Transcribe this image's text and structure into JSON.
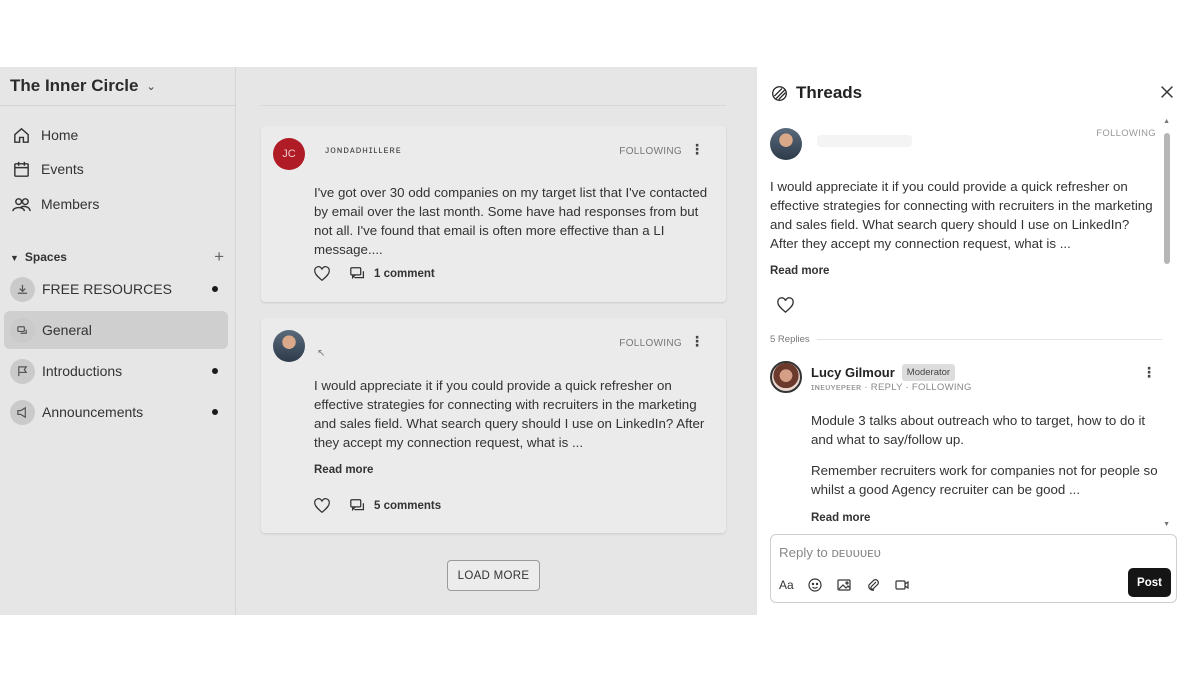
{
  "community": {
    "name": "The Inner Circle"
  },
  "nav": [
    {
      "label": "Home",
      "icon": "home-icon"
    },
    {
      "label": "Events",
      "icon": "calendar-icon"
    },
    {
      "label": "Members",
      "icon": "members-icon"
    }
  ],
  "spaces": {
    "heading": "Spaces",
    "items": [
      {
        "label": "FREE RESOURCES",
        "icon": "download-icon",
        "unread": true,
        "active": false
      },
      {
        "label": "General",
        "icon": "chat-icon",
        "unread": false,
        "active": true
      },
      {
        "label": "Introductions",
        "icon": "flag-icon",
        "unread": true,
        "active": false
      },
      {
        "label": "Announcements",
        "icon": "megaphone-icon",
        "unread": true,
        "active": false
      }
    ]
  },
  "feed": {
    "posts": [
      {
        "avatar_initials": "JC",
        "author": "ᴊᴏɴᴅᴀᴅʜɪʟʟᴇʀᴇ",
        "following": "FOLLOWING",
        "body": "I've got over 30 odd companies on my target list that I've contacted by email over the last month. Some have had responses from but not all. I've found that email is often more effective than a LI message....",
        "comments": "1 comment"
      },
      {
        "sub_glyph": "↖",
        "following": "FOLLOWING",
        "body": "I would appreciate it if you could provide a quick refresher on effective strategies for connecting with recruiters in the marketing and sales field. What search query should I use on LinkedIn? After they accept my connection request, what is ...",
        "read_more": "Read more",
        "comments": "5 comments"
      }
    ],
    "load_more": "LOAD MORE"
  },
  "threads": {
    "title": "Threads",
    "op": {
      "following": "FOLLOWING",
      "body": "I would appreciate it if you could provide a quick refresher on effective strategies for connecting with recruiters in the marketing and sales field. What search query should I use on LinkedIn? After they accept my connection request, what is ...",
      "read_more": "Read more"
    },
    "replies_label": "5 Replies",
    "reply": {
      "name": "Lucy Gilmour",
      "badge": "Moderator",
      "meta": "ɪɴᴇᴜʏᴇᴘᴇᴇʀ · REPLY · FOLLOWING",
      "p1": "Module 3 talks about outreach who to target, how to do it and what to say/follow up.",
      "p2": "Remember recruiters work for companies not for people so whilst a good Agency recruiter can be good ...",
      "read_more": "Read more"
    },
    "composer": {
      "placeholder": "Reply to ᴅᴇᴜᴜᴜᴇᴜ",
      "format_label": "Aa",
      "post_label": "Post"
    }
  }
}
